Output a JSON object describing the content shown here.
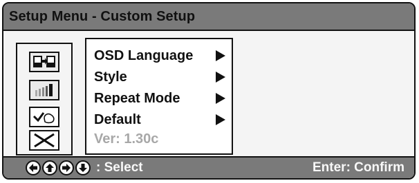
{
  "window": {
    "title": "Setup Menu - Custom Setup"
  },
  "icons": [
    {
      "name": "input-output-icon"
    },
    {
      "name": "level-bars-icon"
    },
    {
      "name": "custom-setup-icon",
      "selected": true
    },
    {
      "name": "close-icon"
    }
  ],
  "menu": {
    "items": [
      {
        "label": "OSD Language"
      },
      {
        "label": "Style"
      },
      {
        "label": "Repeat Mode"
      },
      {
        "label": "Default"
      }
    ],
    "version_label": "Ver:  1.30c"
  },
  "status": {
    "select_label": ": Select",
    "confirm_label": "Enter: Confirm",
    "arrow_keys": [
      "left-arrow-icon",
      "up-arrow-icon",
      "right-arrow-icon",
      "down-arrow-icon"
    ]
  },
  "colors": {
    "bar": "#7a7a7a",
    "panel": "#f4f4f4",
    "disabled_text": "#a8a8a8"
  }
}
